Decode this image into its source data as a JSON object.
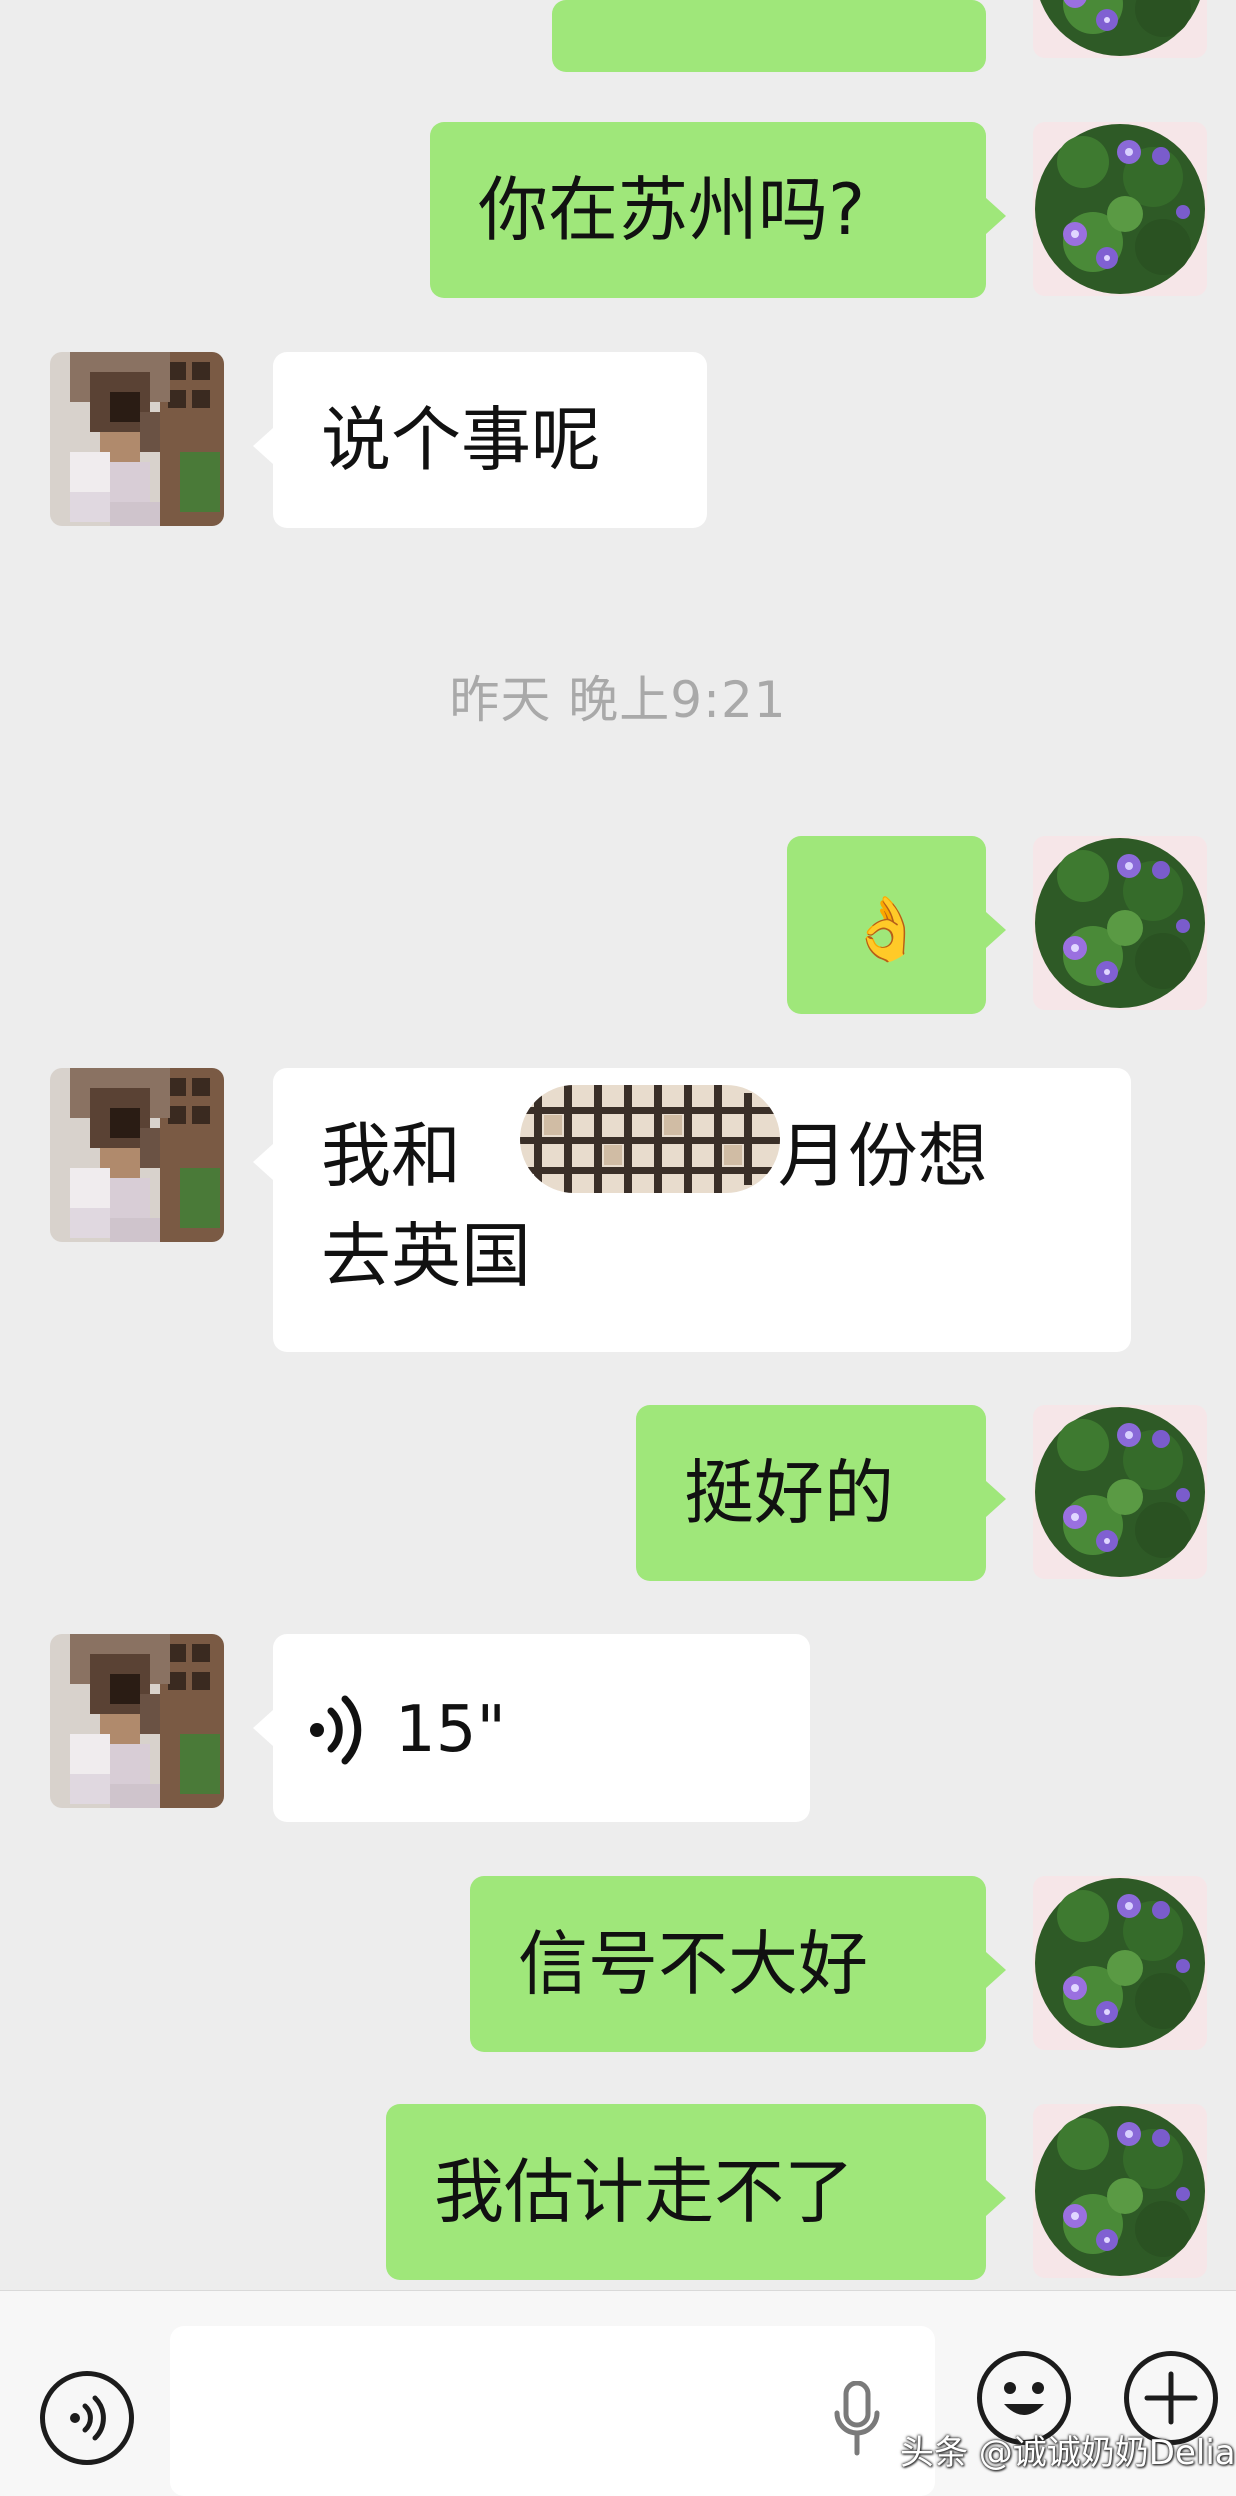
{
  "messages": [
    {
      "side": "right",
      "text": ""
    },
    {
      "side": "right",
      "text": "你在苏州吗?"
    },
    {
      "side": "left",
      "text": "说个事呢"
    },
    {
      "side": "right",
      "text": "👌"
    },
    {
      "side": "left",
      "line1_pre": "我和",
      "line1_post": "9 月份想",
      "line2": "去英国"
    },
    {
      "side": "right",
      "text": "挺好的"
    },
    {
      "side": "left",
      "type": "voice",
      "duration": "15\""
    },
    {
      "side": "right",
      "text": "信号不大好"
    },
    {
      "side": "right",
      "text": "我估计走不了"
    }
  ],
  "timestamp": "昨天 晚上9:21",
  "input": {
    "value": "",
    "placeholder": ""
  },
  "icons": {
    "voice_mode": "voice-wave-icon",
    "mic": "microphone-icon",
    "emoji": "smiley-icon",
    "more": "plus-icon"
  },
  "watermark": "头条 @诚诚奶奶Delia",
  "colors": {
    "background": "#ededed",
    "sent_bubble": "#9fe77a",
    "received_bubble": "#ffffff",
    "timestamp_text": "#a9a9a9"
  }
}
